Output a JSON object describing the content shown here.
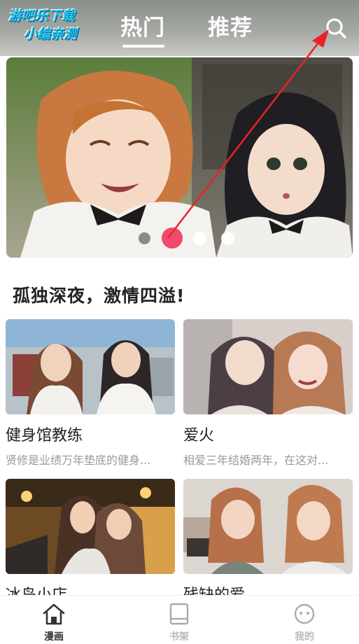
{
  "watermark": {
    "line1": "游吧乐下载",
    "line2": "小编亲测"
  },
  "header": {
    "tabs": [
      {
        "label": "热门",
        "active": true
      },
      {
        "label": "推荐",
        "active": false
      }
    ],
    "search_icon": "search-icon"
  },
  "banner": {
    "slides_count": 4,
    "active_index": 1,
    "active_color": "#f04a6c"
  },
  "section": {
    "title": "孤独深夜，激情四溢!"
  },
  "cards": [
    {
      "title": "健身馆教练",
      "desc": "贤修是业绩万年垫底的健身..."
    },
    {
      "title": "爱火",
      "desc": "相爱三年结婚两年，在这对..."
    },
    {
      "title": "冰岛小店",
      "desc": ""
    },
    {
      "title": "残缺的爱",
      "desc": ""
    }
  ],
  "bottom_nav": [
    {
      "label": "漫画",
      "icon": "home-icon",
      "active": true
    },
    {
      "label": "书架",
      "icon": "bookshelf-icon",
      "active": false
    },
    {
      "label": "我的",
      "icon": "profile-icon",
      "active": false
    }
  ]
}
